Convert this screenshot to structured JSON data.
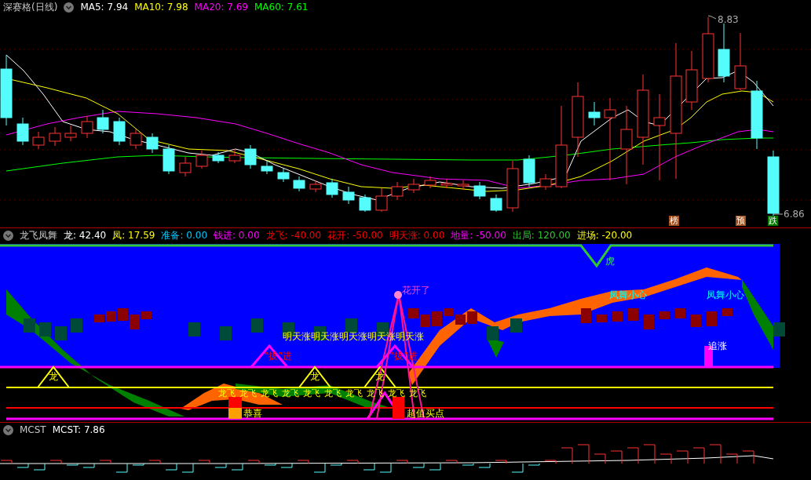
{
  "price_pane": {
    "stock_name": "深赛格(日线)",
    "indicators": [
      {
        "label": "MA5: 7.94",
        "color": "#ffffff"
      },
      {
        "label": "MA10: 7.98",
        "color": "#ffff00"
      },
      {
        "label": "MA20: 7.69",
        "color": "#ff00ff"
      },
      {
        "label": "MA60: 7.61",
        "color": "#00ff00"
      }
    ],
    "high_label": "8.83",
    "low_label": "6.86",
    "signals": [
      {
        "text": "榜",
        "color": "#a0501e"
      },
      {
        "text": "预",
        "color": "#a0501e"
      },
      {
        "text": "跌",
        "color": "#007800"
      }
    ]
  },
  "indicator_pane": {
    "name": "龙飞凤舞",
    "indicators": [
      {
        "label": "龙: 42.40",
        "color": "#ffffff"
      },
      {
        "label": "凤: 17.59",
        "color": "#ffff00"
      },
      {
        "label": "准备: 0.00",
        "color": "#00c8ff"
      },
      {
        "label": "钱进: 0.00",
        "color": "#ff00ff"
      },
      {
        "label": "龙飞: -40.00",
        "color": "#ff0000"
      },
      {
        "label": "花开: -50.00",
        "color": "#ff0000"
      },
      {
        "label": "明天涨: 0.00",
        "color": "#ff0000"
      },
      {
        "label": "地量: -50.00",
        "color": "#ff00ff"
      },
      {
        "label": "出局: 120.00",
        "color": "#32c832"
      },
      {
        "label": "进场: -20.00",
        "color": "#ffff00"
      }
    ],
    "tomorrow_labels": [
      "明天涨",
      "明天涨",
      "明天涨",
      "明天涨",
      "明天涨"
    ],
    "dragon_labels": [
      "龙",
      "龙",
      "龙"
    ],
    "dragon_fly_labels": [
      "龙飞",
      "龙飞",
      "龙飞",
      "龙飞",
      "龙飞",
      "龙飞",
      "龙飞",
      "龙飞",
      "龙飞",
      "龙飞"
    ],
    "pull_labels": [
      "“拔”进",
      "“拔”进"
    ],
    "flower_label": "花开了",
    "congrats_label": "恭喜",
    "buy_label": "超值买点",
    "tiger_label": "虎",
    "caution_labels": [
      "凤舞小心",
      "凤舞小心"
    ],
    "chase_label": "追涨"
  },
  "mcst_pane": {
    "name": "MCST",
    "value": "MCST: 7.86"
  }
}
